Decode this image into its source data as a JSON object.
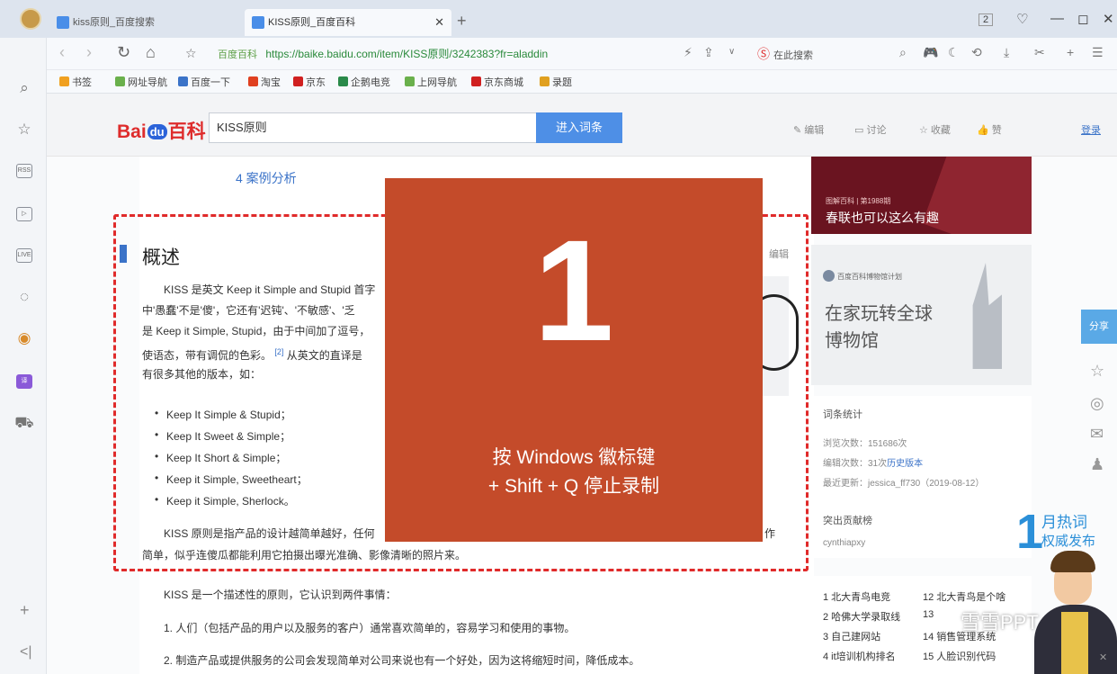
{
  "browser": {
    "tabs": [
      {
        "label": "kiss原则_百度搜索",
        "active": false
      },
      {
        "label": "KISS原则_百度百科",
        "active": true
      }
    ],
    "tab_count": "2",
    "url_site": "百度百科",
    "url": "https://baike.baidu.com/item/KISS原则/3242383?fr=aladdin",
    "search_label": "在此搜索",
    "bookmarks": [
      "书签",
      "网址导航",
      "百度一下",
      "淘宝",
      "京东",
      "企鹅电竞",
      "上网导航",
      "京东商城",
      "录题"
    ]
  },
  "baike": {
    "logo": {
      "bai": "Bai",
      "du": "du",
      "baike": "百科"
    },
    "search_value": "KISS原则",
    "enter_button": "进入词条",
    "tools": [
      "编辑",
      "讨论",
      "收藏",
      "赞"
    ],
    "login": "登录"
  },
  "article": {
    "toc_item": "4 案例分析",
    "section_title": "概述",
    "edit_link": "编辑",
    "para1": [
      "KISS 是英文 Keep it Simple and Stupid 首字",
      "中'愚蠢'不是'傻'，它还有'迟钝'、'不敏感'、'乏",
      "是 Keep it Simple, Stupid，由于中间加了逗号，",
      "使语态，带有调侃的色彩。",
      "有很多其他的版本，如："
    ],
    "ref_note": "[2]",
    "para1_tail": "从英文的直译是",
    "bullets": [
      "Keep It Simple & Stupid；",
      "Keep It Sweet & Simple；",
      "Keep It Short & Simple；",
      "Keep it Simple, Sweetheart；",
      "Keep it Simple, Sherlock。"
    ],
    "para2_line1": "KISS 原则是指产品的设计越简单越好，任何",
    "para2_tail": "作",
    "para2_line2": "简单，似乎连傻瓜都能利用它拍摄出曝光准确、影像清晰的照片来。",
    "para3": "KISS 是一个描述性的原则，它认识到两件事情：",
    "item1": "1. 人们（包括产品的用户以及服务的客户）通常喜欢简单的，容易学习和使用的事物。",
    "item2": "2. 制造产品或提供服务的公司会发现简单对公司来说也有一个好处，因为这将缩短时间，降低成本。"
  },
  "overlay": {
    "number": "1",
    "line1": "按 Windows 徽标键",
    "line2": "+ Shift + Q 停止录制"
  },
  "right_panel": {
    "banner1_small": "图解百科 | 第1988期",
    "banner1_title": "春联也可以这么有趣",
    "banner2_logo": "百度百科博物馆计划",
    "banner2_line1": "在家玩转全球",
    "banner2_line2": "博物馆",
    "stats_title": "词条统计",
    "stats_views_label": "浏览次数：",
    "stats_views": "151686次",
    "stats_edits_label": "编辑次数：",
    "stats_edits": "31次",
    "stats_history": "历史版本",
    "stats_updated_label": "最近更新：",
    "stats_updated": "jessica_ff730（2019-08-12）",
    "contrib_title": "突出贡献榜",
    "contrib_user": "cynthiapxy",
    "hot_list": [
      "1 北大青鸟电竞",
      "12 北大青鸟是个啥",
      "2 哈佛大学录取线",
      "13",
      "3 自己建网站",
      "14 销售管理系统",
      "4 it培训机构排名",
      "15 人脸识别代码"
    ],
    "yue_num": "1",
    "yue_title": "月热词",
    "yue_sub": "权威发布",
    "share": "分享"
  },
  "watermark": "雪雪PPT"
}
